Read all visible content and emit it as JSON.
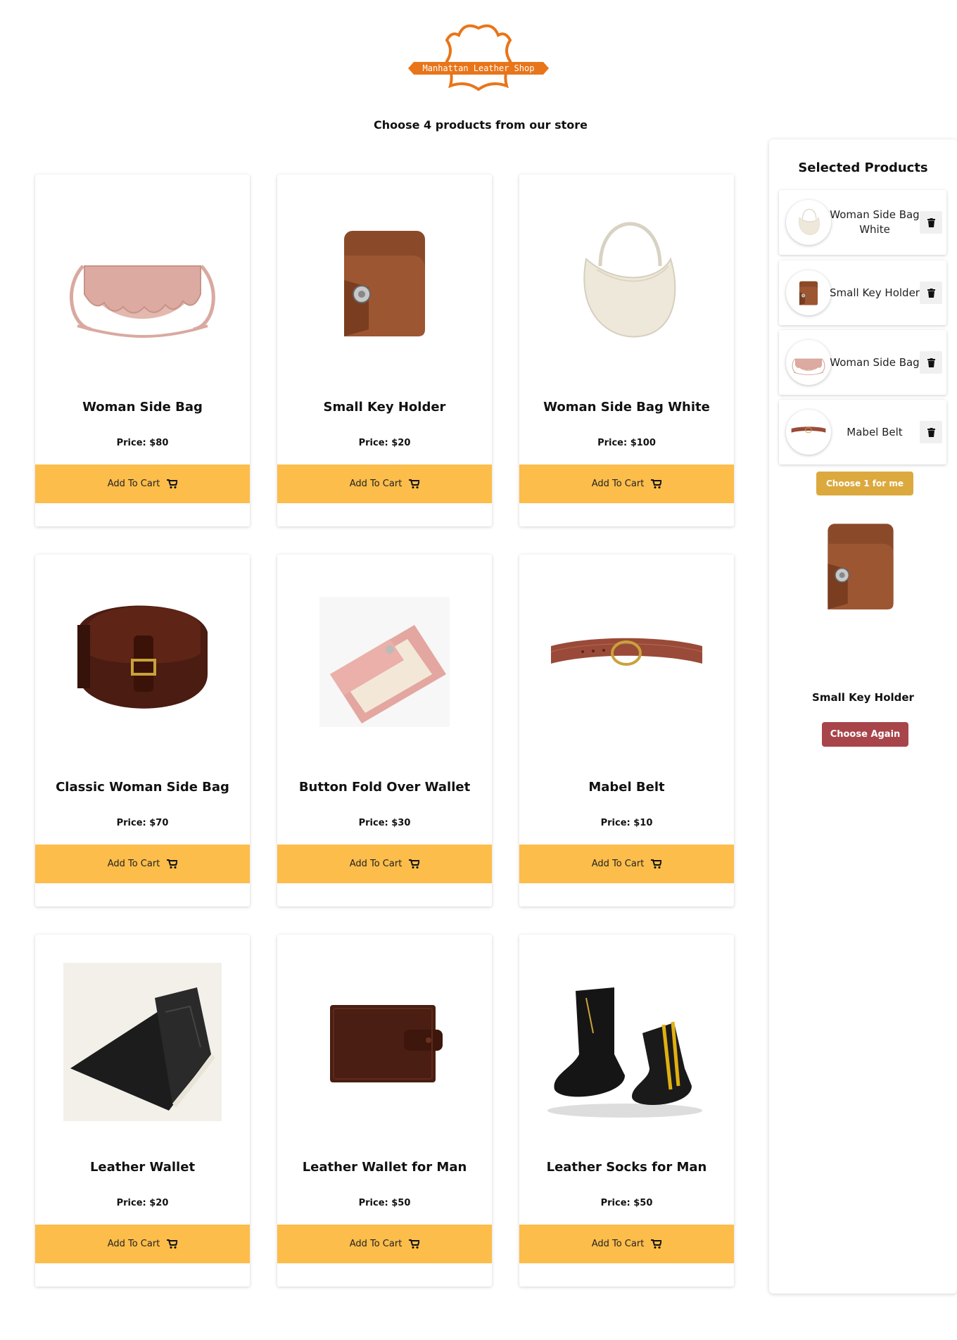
{
  "brand": {
    "name": "Manhattan Leather Shop",
    "color": "#e8751a"
  },
  "headline": "Choose 4 products from our store",
  "accent": {
    "cart_button": "#fcbd4b",
    "choose_button": "#dca93f",
    "again_button": "#a8454a"
  },
  "products": [
    {
      "name": "Woman Side Bag",
      "price": "Price: $80",
      "cta": "Add To Cart",
      "image": "woman-side-bag-image"
    },
    {
      "name": "Small Key Holder",
      "price": "Price: $20",
      "cta": "Add To Cart",
      "image": "small-key-holder-image"
    },
    {
      "name": "Woman Side Bag White",
      "price": "Price: $100",
      "cta": "Add To Cart",
      "image": "woman-side-bag-white-image"
    },
    {
      "name": "Classic Woman Side Bag",
      "price": "Price: $70",
      "cta": "Add To Cart",
      "image": "classic-woman-side-bag-image"
    },
    {
      "name": "Button Fold Over Wallet",
      "price": "Price: $30",
      "cta": "Add To Cart",
      "image": "button-fold-over-wallet-image"
    },
    {
      "name": "Mabel Belt",
      "price": "Price: $10",
      "cta": "Add To Cart",
      "image": "mabel-belt-image"
    },
    {
      "name": "Leather Wallet",
      "price": "Price: $20",
      "cta": "Add To Cart",
      "image": "leather-wallet-image"
    },
    {
      "name": "Leather Wallet for Man",
      "price": "Price: $50",
      "cta": "Add To Cart",
      "image": "leather-wallet-for-man-image"
    },
    {
      "name": "Leather Socks for Man",
      "price": "Price: $50",
      "cta": "Add To Cart",
      "image": "leather-socks-for-man-image"
    }
  ],
  "sidebar": {
    "title": "Selected Products",
    "items": [
      {
        "name": "Woman Side Bag White",
        "icon": "trash-icon"
      },
      {
        "name": "Small Key Holder",
        "icon": "trash-icon"
      },
      {
        "name": "Woman Side Bag",
        "icon": "trash-icon"
      },
      {
        "name": "Mabel Belt",
        "icon": "trash-icon"
      }
    ],
    "choose_label": "Choose 1 for me",
    "chosen_name": "Small Key Holder",
    "again_label": "Choose Again"
  }
}
